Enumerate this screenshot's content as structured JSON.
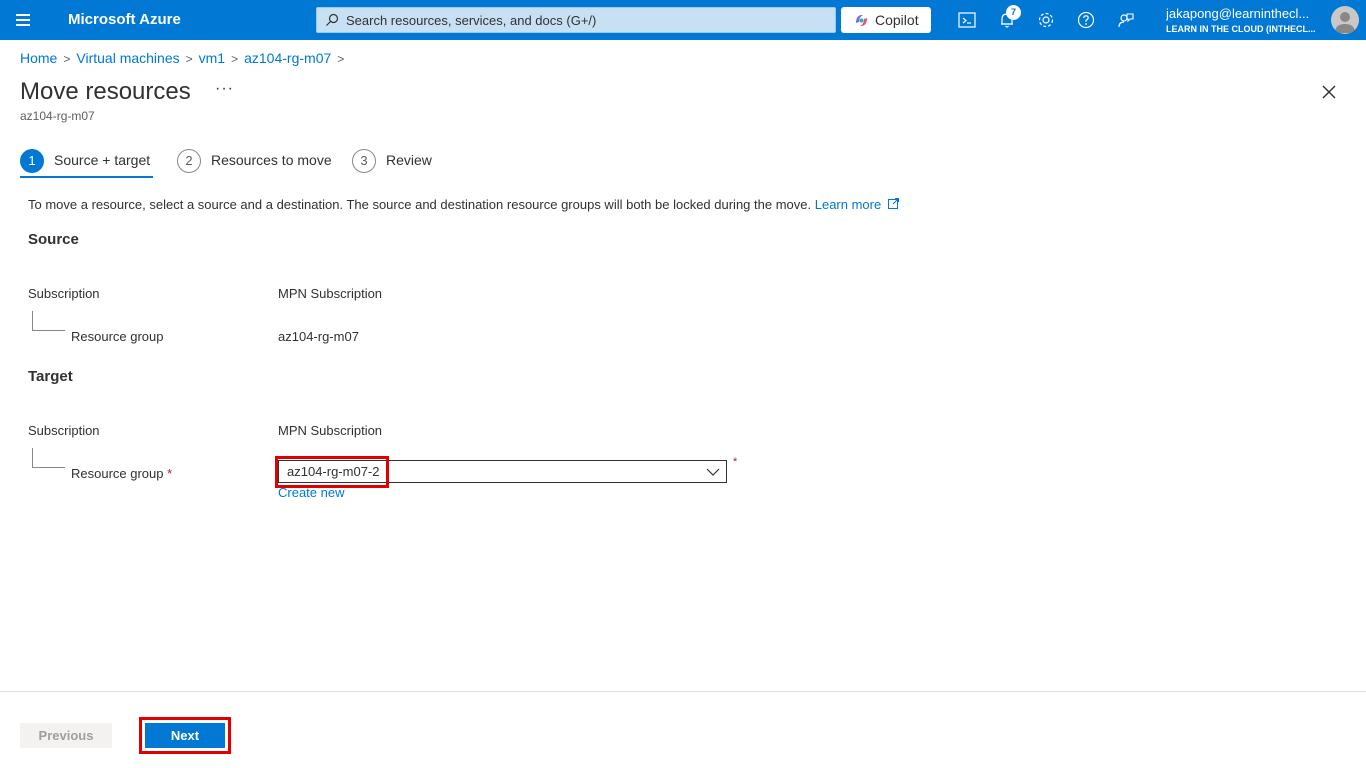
{
  "topbar": {
    "brand": "Microsoft Azure",
    "search_placeholder": "Search resources, services, and docs (G+/)",
    "copilot_label": "Copilot",
    "notifications_count": "7",
    "user_email": "jakapong@learninthecl...",
    "user_tenant": "LEARN IN THE CLOUD (INTHECL..."
  },
  "breadcrumb": [
    "Home",
    "Virtual machines",
    "vm1",
    "az104-rg-m07"
  ],
  "page": {
    "title": "Move resources",
    "more": "···",
    "subtitle": "az104-rg-m07"
  },
  "steps": [
    {
      "num": "1",
      "label": "Source + target",
      "active": true
    },
    {
      "num": "2",
      "label": "Resources to move",
      "active": false
    },
    {
      "num": "3",
      "label": "Review",
      "active": false
    }
  ],
  "description": {
    "text": "To move a resource, select a source and a destination. The source and destination resource groups will both be locked during the move.",
    "link": "Learn more"
  },
  "source": {
    "heading": "Source",
    "subscription_label": "Subscription",
    "subscription_value": "MPN Subscription",
    "rg_label": "Resource group",
    "rg_value": "az104-rg-m07"
  },
  "target": {
    "heading": "Target",
    "subscription_label": "Subscription",
    "subscription_value": "MPN Subscription",
    "rg_label": "Resource group",
    "required_mark": "*",
    "rg_selected": "az104-rg-m07-2",
    "create_new": "Create new"
  },
  "footer": {
    "previous": "Previous",
    "next": "Next"
  },
  "colors": {
    "accent": "#0078d4",
    "highlight": "#e00000",
    "required": "#a4262c"
  }
}
